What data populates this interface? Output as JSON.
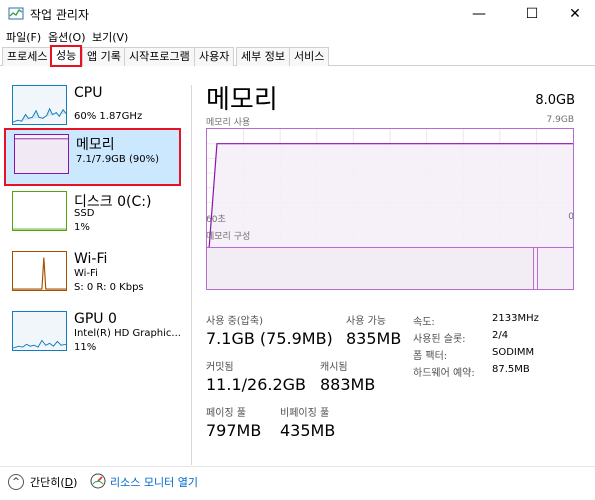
{
  "window": {
    "title": "작업 관리자",
    "min": "—",
    "max": "☐",
    "close": "✕"
  },
  "menu": [
    "파일(F)",
    "옵션(O)",
    "보기(V)"
  ],
  "tabs": [
    "프로세스",
    "성능",
    "앱 기록",
    "시작프로그램",
    "사용자",
    "세부 정보",
    "서비스"
  ],
  "active_tab": "성능",
  "sidebar": [
    {
      "name": "CPU",
      "sub1": "60%  1.87GHz",
      "color": "#117dbb",
      "bg": "#f1f6fa"
    },
    {
      "name": "메모리",
      "sub1": "7.1/7.9GB (90%)",
      "color": "#8b12ae",
      "bg": "#f4f2f4"
    },
    {
      "name": "디스크 0(C:)",
      "sub1": "SSD",
      "sub2": "1%",
      "color": "#4da60c",
      "bg": "#ffffff"
    },
    {
      "name": "Wi-Fi",
      "sub1": "Wi-Fi",
      "sub2": "S: 0  R: 0 Kbps",
      "color": "#a74f01",
      "bg": "#ffffff"
    },
    {
      "name": "GPU 0",
      "sub1": "Intel(R) HD Graphic...",
      "sub2": "11%",
      "color": "#117dbb",
      "bg": "#ffffff"
    }
  ],
  "main": {
    "title": "메모리",
    "total": "8.0GB",
    "usage_label": "메모리 사용",
    "usage_max": "7.9GB",
    "axis_left": "60초",
    "axis_right": "0",
    "composition_label": "메모리 구성",
    "usage_fraction": 0.9
  },
  "stats": {
    "in_use_label": "사용 중(압축)",
    "in_use_value": "7.1GB (75.9MB)",
    "available_label": "사용 가능",
    "available_value": "835MB",
    "committed_label": "커밋됨",
    "committed_value": "11.1/26.2GB",
    "cached_label": "캐시됨",
    "cached_value": "883MB",
    "paged_label": "페이징 풀",
    "paged_value": "797MB",
    "nonpaged_label": "비페이징 풀",
    "nonpaged_value": "435MB"
  },
  "specs": {
    "speed_label": "속도:",
    "speed_value": "2133MHz",
    "slots_label": "사용된 슬롯:",
    "slots_value": "2/4",
    "form_label": "폼 팩터:",
    "form_value": "SODIMM",
    "hw_label": "하드웨어 예약:",
    "hw_value": "87.5MB"
  },
  "footer": {
    "fewer_prefix": "간단히(",
    "fewer_key": "D",
    "fewer_suffix": ")",
    "resmon": "리소스 모니터 열기"
  }
}
